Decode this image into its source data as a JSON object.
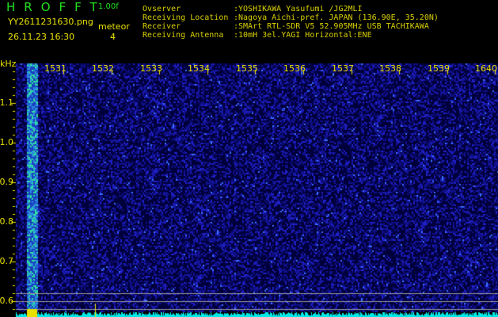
{
  "header": {
    "app_title": "HROFFT",
    "version": "1.00f",
    "filename": "YY2611231630.png",
    "timestamp": "26.11.23 16:30",
    "meteor_label": "meteor",
    "meteor_count": "4"
  },
  "info": [
    {
      "key": "Ovserver",
      "value": ":YOSHIKAWA Yasufumi /JG2MLI"
    },
    {
      "key": "Receiving Location",
      "value": ":Nagoya Aichi-pref. JAPAN (136.90E, 35.20N)"
    },
    {
      "key": "Receiver",
      "value": ":SMArt RTL-SDR V5 52.905MHz USB TACHIKAWA"
    },
    {
      "key": "Receiving Antenna",
      "value": ":10mH 3el.YAGI Horizontal:ENE"
    }
  ],
  "axes": {
    "y_unit": "kHz",
    "y_ticks": [
      "1.1",
      "1.0",
      "0.9",
      "0.8",
      "0.7",
      "0.6"
    ],
    "x_ticks": [
      "1531",
      "1532",
      "1533",
      "1534",
      "1535",
      "1536",
      "1537",
      "1538",
      "1539",
      "1640"
    ]
  },
  "colors": {
    "text": "#e8e000",
    "title": "#22e022",
    "background_noise": "#1010a0",
    "level_bars": "#00e8e8"
  }
}
